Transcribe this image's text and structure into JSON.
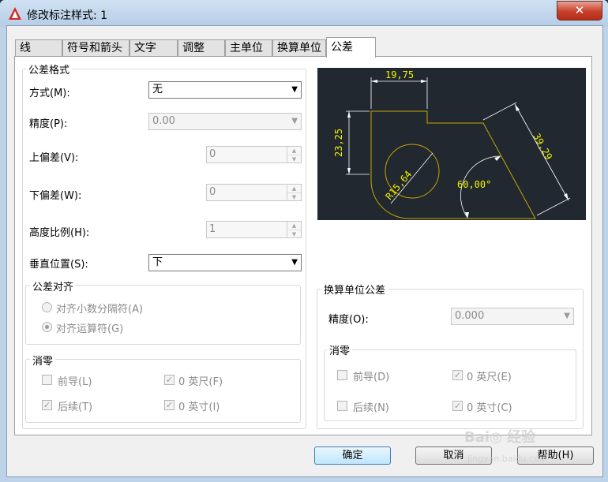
{
  "window": {
    "title": "修改标注样式: 1",
    "close_label": "✕"
  },
  "tabs": [
    {
      "label": "线"
    },
    {
      "label": "符号和箭头"
    },
    {
      "label": "文字"
    },
    {
      "label": "调整"
    },
    {
      "label": "主单位"
    },
    {
      "label": "换算单位"
    },
    {
      "label": "公差"
    }
  ],
  "tolerance_format": {
    "legend": "公差格式",
    "method": {
      "label": "方式(M):",
      "value": "无"
    },
    "precision": {
      "label": "精度(P):",
      "value": "0.00"
    },
    "upper": {
      "label": "上偏差(V):",
      "value": "0"
    },
    "lower": {
      "label": "下偏差(W):",
      "value": "0"
    },
    "height_scale": {
      "label": "高度比例(H):",
      "value": "1"
    },
    "vertical_pos": {
      "label": "垂直位置(S):",
      "value": "下"
    }
  },
  "alignment": {
    "legend": "公差对齐",
    "opt1": "对齐小数分隔符(A)",
    "opt2": "对齐运算符(G)"
  },
  "zero_left": {
    "legend": "消零",
    "leading": "前导(L)",
    "trailing": "后续(T)",
    "feet": "0 英尺(F)",
    "inches": "0 英寸(I)"
  },
  "alt_units": {
    "legend": "换算单位公差",
    "precision": {
      "label": "精度(O):",
      "value": "0.000"
    }
  },
  "zero_right": {
    "legend": "消零",
    "leading": "前导(D)",
    "trailing": "后续(N)",
    "feet": "0 英尺(E)",
    "inches": "0 英寸(C)"
  },
  "preview": {
    "dim_top": "19,75",
    "dim_left": "23,25",
    "dim_diag": "39,29",
    "dim_radius": "R15,64",
    "dim_angle": "60,00°",
    "dim_color": "#f2f200",
    "geom_color": "#c9a600",
    "line_color": "#ffffff"
  },
  "buttons": {
    "ok": "确定",
    "cancel": "取消",
    "help": "帮助(H)"
  },
  "watermark": {
    "text": "Bai◎ 经验",
    "sub": "jingyan.baidu.com"
  }
}
